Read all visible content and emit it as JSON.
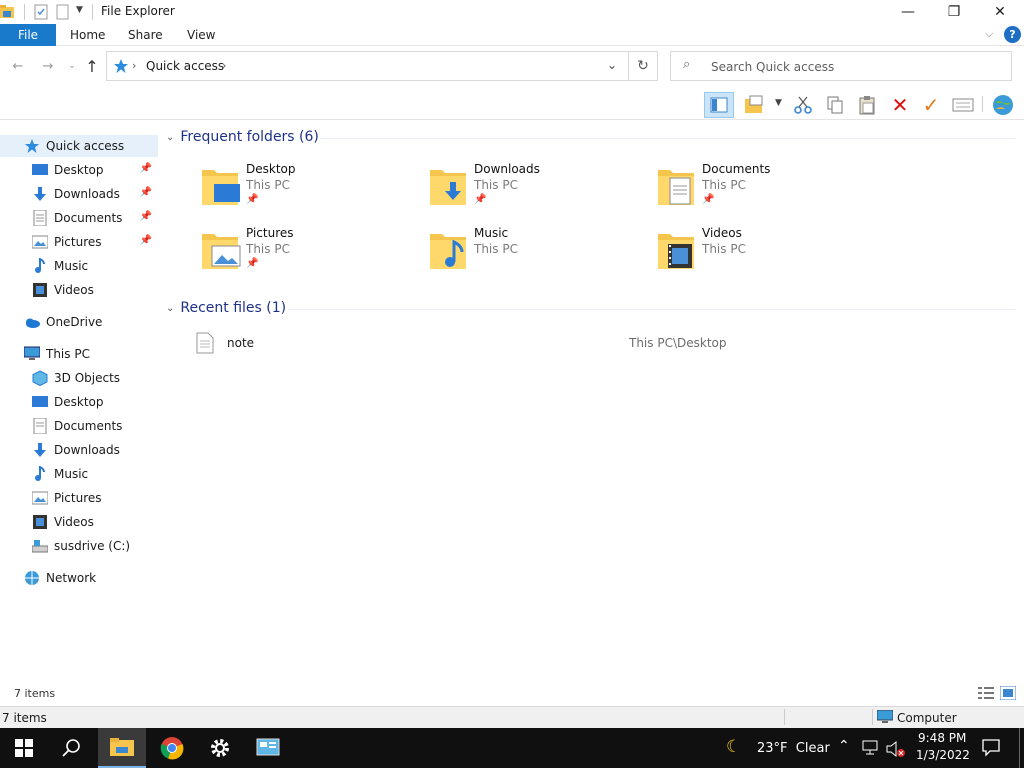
{
  "window": {
    "title": "File Explorer",
    "controls": {
      "minimize": "—",
      "restore": "❐",
      "close": "✕"
    }
  },
  "ribbon": {
    "tabs": [
      "File",
      "Home",
      "Share",
      "View"
    ],
    "help": "?"
  },
  "address": {
    "path_label": "Quick access",
    "search_placeholder": "Search Quick access"
  },
  "nav": {
    "quick_access": "Quick access",
    "quick_items": [
      {
        "label": "Desktop",
        "icon": "desktop-icon",
        "pinned": true
      },
      {
        "label": "Downloads",
        "icon": "downloads-icon",
        "pinned": true
      },
      {
        "label": "Documents",
        "icon": "documents-icon",
        "pinned": true
      },
      {
        "label": "Pictures",
        "icon": "pictures-icon",
        "pinned": true
      },
      {
        "label": "Music",
        "icon": "music-icon",
        "pinned": false
      },
      {
        "label": "Videos",
        "icon": "videos-icon",
        "pinned": false
      }
    ],
    "onedrive": "OneDrive",
    "this_pc": "This PC",
    "pc_items": [
      {
        "label": "3D Objects",
        "icon": "3d-objects-icon"
      },
      {
        "label": "Desktop",
        "icon": "desktop-icon"
      },
      {
        "label": "Documents",
        "icon": "documents-icon"
      },
      {
        "label": "Downloads",
        "icon": "downloads-icon"
      },
      {
        "label": "Music",
        "icon": "music-icon"
      },
      {
        "label": "Pictures",
        "icon": "pictures-icon"
      },
      {
        "label": "Videos",
        "icon": "videos-icon"
      },
      {
        "label": "susdrive (C:)",
        "icon": "drive-icon"
      }
    ],
    "network": "Network"
  },
  "content": {
    "frequent_header": "Frequent folders (6)",
    "folders": [
      {
        "name": "Desktop",
        "location": "This PC",
        "pinned": true
      },
      {
        "name": "Downloads",
        "location": "This PC",
        "pinned": true
      },
      {
        "name": "Documents",
        "location": "This PC",
        "pinned": true
      },
      {
        "name": "Pictures",
        "location": "This PC",
        "pinned": true
      },
      {
        "name": "Music",
        "location": "This PC",
        "pinned": false
      },
      {
        "name": "Videos",
        "location": "This PC",
        "pinned": false
      }
    ],
    "recent_header": "Recent files (1)",
    "recent": [
      {
        "name": "note",
        "path": "This PC\\Desktop"
      }
    ]
  },
  "status": {
    "items_count": "7 items",
    "bottom_items": "7 items",
    "computer": "Computer"
  },
  "taskbar": {
    "weather": "23°F  Clear",
    "time": "9:48 PM",
    "date": "1/3/2022"
  },
  "colors": {
    "accent": "#1979ca",
    "folder": "#f5c54e",
    "header_text": "#1e3287",
    "selected_bg": "#e5f0fb"
  }
}
